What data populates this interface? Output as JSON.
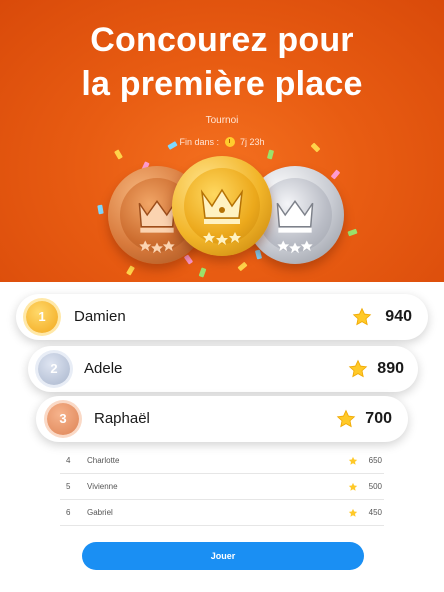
{
  "hero": {
    "headline_line1": "Concourez pour",
    "headline_line2": "la première place",
    "tournament_label": "Tournoi",
    "ends_in_label": "Fin dans :",
    "ends_in_value": "7j 23h",
    "colors": {
      "background": "#e85c12",
      "accent": "#ffcd2e"
    }
  },
  "podium": [
    {
      "rank": "1",
      "name": "Damien",
      "score": "940",
      "medal": "gold"
    },
    {
      "rank": "2",
      "name": "Adele",
      "score": "890",
      "medal": "silver"
    },
    {
      "rank": "3",
      "name": "Raphaël",
      "score": "700",
      "medal": "bronze"
    }
  ],
  "list": [
    {
      "rank": "4",
      "name": "Charlotte",
      "score": "650"
    },
    {
      "rank": "5",
      "name": "Vivienne",
      "score": "500"
    },
    {
      "rank": "6",
      "name": "Gabriel",
      "score": "450"
    }
  ],
  "actions": {
    "play_label": "Jouer",
    "play_color": "#1a8ff3"
  },
  "icons": {
    "score": "star-icon",
    "timer": "clock-icon",
    "medal_emblem": "crown-icon"
  }
}
